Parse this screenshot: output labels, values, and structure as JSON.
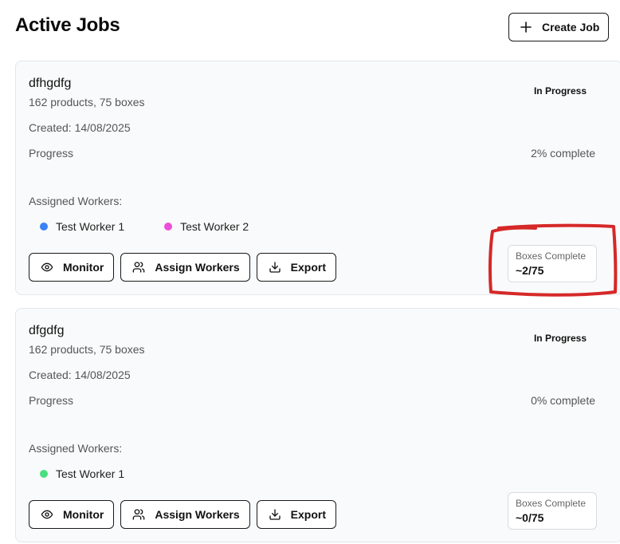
{
  "header": {
    "title": "Active Jobs",
    "create_label": "Create Job"
  },
  "jobs": [
    {
      "name": "dfhgdfg",
      "summary": "162 products, 75 boxes",
      "created": "Created: 14/08/2025",
      "status": "In Progress",
      "progress_label": "Progress",
      "progress_pct": "2% complete",
      "progress_value": 0.02,
      "workers_label": "Assigned Workers:",
      "workers": [
        {
          "name": "Test Worker 1",
          "color": "#3b82f6"
        },
        {
          "name": "Test Worker 2",
          "color": "#ec4fd8"
        }
      ],
      "actions": {
        "monitor": "Monitor",
        "assign": "Assign Workers",
        "export": "Export"
      },
      "boxes_label": "Boxes Complete",
      "boxes_value": "~2/75"
    },
    {
      "name": "dfgdfg",
      "summary": "162 products, 75 boxes",
      "created": "Created: 14/08/2025",
      "status": "In Progress",
      "progress_label": "Progress",
      "progress_pct": "0% complete",
      "progress_value": 0,
      "workers_label": "Assigned Workers:",
      "workers": [
        {
          "name": "Test Worker 1",
          "color": "#4ade80"
        }
      ],
      "actions": {
        "monitor": "Monitor",
        "assign": "Assign Workers",
        "export": "Export"
      },
      "boxes_label": "Boxes Complete",
      "boxes_value": "~0/75"
    }
  ],
  "annotation": {
    "color": "#d62828"
  }
}
